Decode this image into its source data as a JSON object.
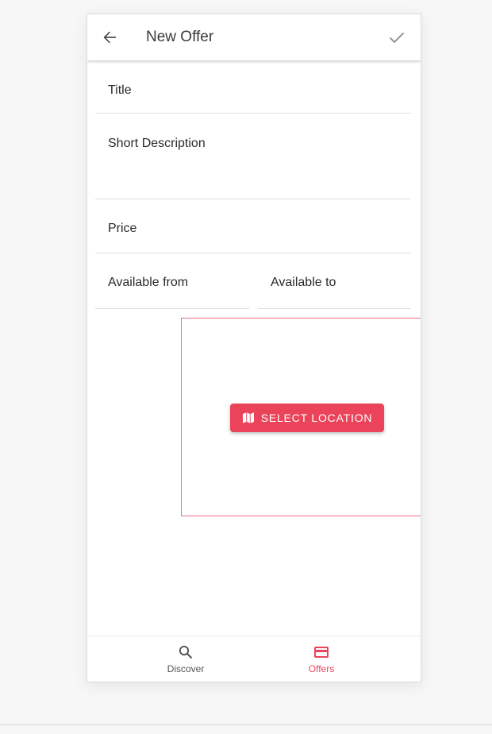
{
  "header": {
    "title": "New Offer",
    "back_icon": "arrow-back-icon",
    "confirm_icon": "checkmark-icon"
  },
  "form": {
    "title_placeholder": "Title",
    "description_placeholder": "Short Description",
    "price_placeholder": "Price",
    "available_from_placeholder": "Available from",
    "available_to_placeholder": "Available to"
  },
  "location": {
    "button_label": "SELECT LOCATION",
    "button_icon": "map-icon"
  },
  "tabs": [
    {
      "label": "Discover",
      "icon": "search-icon",
      "active": false
    },
    {
      "label": "Offers",
      "icon": "card-icon",
      "active": true
    }
  ],
  "colors": {
    "accent": "#eb445a",
    "map_border": "#ef6b86",
    "text": "#3a3a3a",
    "inactive_tab": "#555555"
  }
}
